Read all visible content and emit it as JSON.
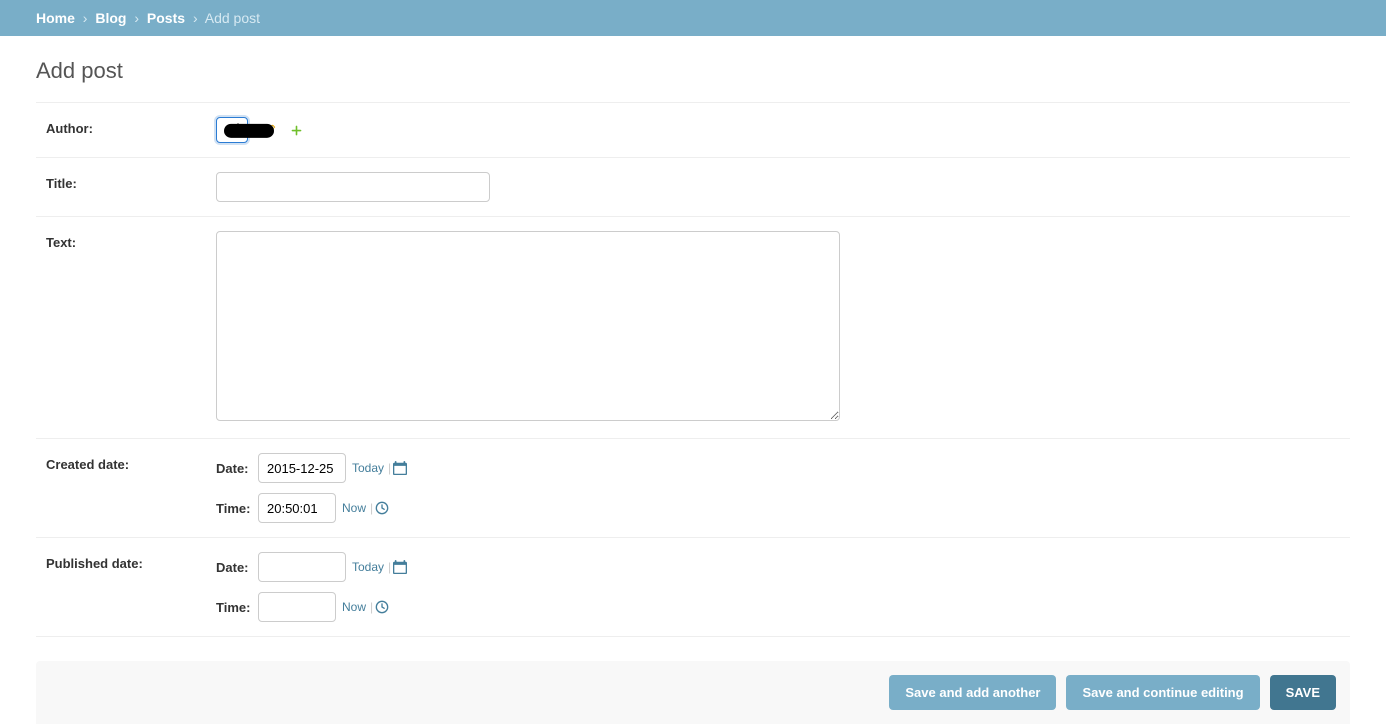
{
  "breadcrumb": {
    "home": "Home",
    "blog": "Blog",
    "posts": "Posts",
    "current": "Add post"
  },
  "page": {
    "title": "Add post"
  },
  "labels": {
    "author": "Author:",
    "title": "Title:",
    "text": "Text:",
    "created_date": "Created date:",
    "published_date": "Published date:",
    "date": "Date:",
    "time": "Time:"
  },
  "shortcuts": {
    "today": "Today",
    "now": "Now"
  },
  "values": {
    "author_selected": "",
    "title": "",
    "text": "",
    "created_date": "2015-12-25",
    "created_time": "20:50:01",
    "published_date": "",
    "published_time": ""
  },
  "buttons": {
    "save_add_another": "Save and add another",
    "save_continue": "Save and continue editing",
    "save": "SAVE"
  }
}
